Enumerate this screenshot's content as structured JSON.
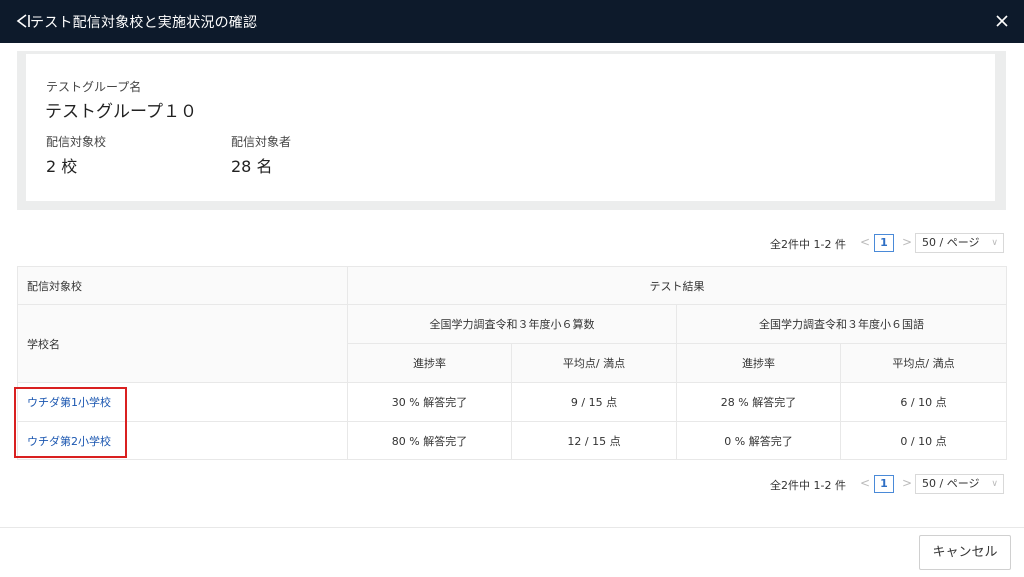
{
  "window": {
    "title": "テスト配信対象校と実施状況の確認"
  },
  "summary": {
    "group_label": "テストグループ名",
    "group_value": "テストグループ１０",
    "schools_label": "配信対象校",
    "schools_value": "2 校",
    "people_label": "配信対象者",
    "people_value": "28 名"
  },
  "pagination": {
    "total_text": "全2件中 1-2 件",
    "prev": "<",
    "current_page": "1",
    "next": ">",
    "page_size": "50 / ページ"
  },
  "table": {
    "header_school": "配信対象校",
    "header_results": "テスト結果",
    "header_school_name": "学校名",
    "tests": [
      "全国学力調査令和３年度小６算数",
      "全国学力調査令和３年度小６国語"
    ],
    "sub_headers": [
      "進捗率",
      "平均点/ 満点"
    ],
    "rows": [
      {
        "school": "ウチダ第1小学校",
        "cells": [
          "30 % 解答完了",
          "9 / 15 点",
          "28 % 解答完了",
          "6 / 10 点"
        ]
      },
      {
        "school": "ウチダ第2小学校",
        "cells": [
          "80 % 解答完了",
          "12 / 15 点",
          "0 % 解答完了",
          "0 / 10 点"
        ]
      }
    ]
  },
  "buttons": {
    "cancel": "キャンセル"
  },
  "colors": {
    "titlebar": "#0d1a2b",
    "link": "#1a56b0",
    "highlight": "#d92020",
    "page_accent": "#4a8ad8"
  },
  "icons": {
    "back": "back-triangle-icon",
    "close": "close-icon"
  }
}
